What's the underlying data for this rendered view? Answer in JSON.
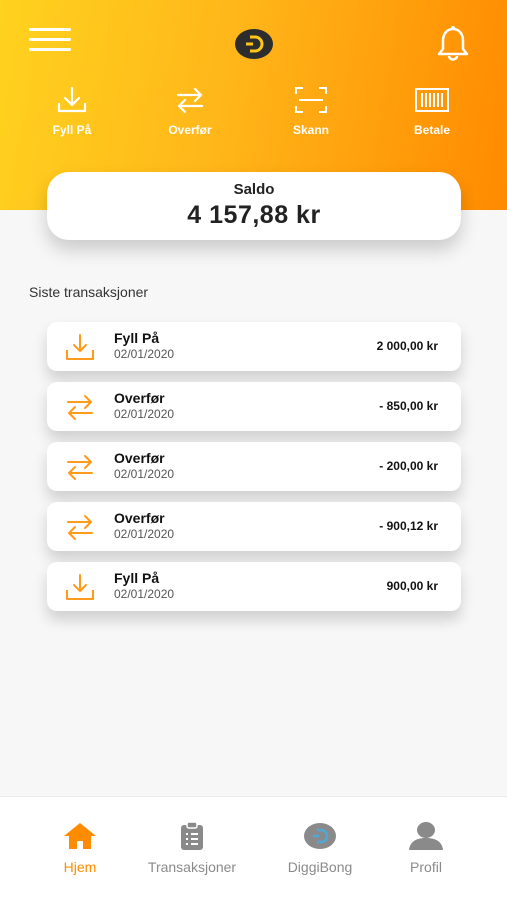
{
  "header": {
    "actions": [
      {
        "label": "Fyll På",
        "icon": "download-icon"
      },
      {
        "label": "Overfør",
        "icon": "transfer-arrows-icon"
      },
      {
        "label": "Skann",
        "icon": "scan-icon"
      },
      {
        "label": "Betale",
        "icon": "barcode-icon"
      }
    ]
  },
  "balance": {
    "title": "Saldo",
    "value": "4 157,88 kr"
  },
  "transactions": {
    "title": "Siste transaksjoner",
    "items": [
      {
        "name": "Fyll På",
        "date": "02/01/2020",
        "amount": "2 000,00 kr",
        "icon": "download-icon"
      },
      {
        "name": "Overfør",
        "date": "02/01/2020",
        "amount": "- 850,00 kr",
        "icon": "transfer-arrows-icon"
      },
      {
        "name": "Overfør",
        "date": "02/01/2020",
        "amount": "- 200,00 kr",
        "icon": "transfer-arrows-icon"
      },
      {
        "name": "Overfør",
        "date": "02/01/2020",
        "amount": "- 900,12 kr",
        "icon": "transfer-arrows-icon"
      },
      {
        "name": "Fyll På",
        "date": "02/01/2020",
        "amount": "900,00 kr",
        "icon": "download-icon"
      }
    ]
  },
  "nav": {
    "items": [
      {
        "label": "Hjem",
        "icon": "home-icon",
        "active": true
      },
      {
        "label": "Transaksjoner",
        "icon": "clipboard-icon",
        "active": false
      },
      {
        "label": "DiggiBong",
        "icon": "diggibong-logo-icon",
        "active": false
      },
      {
        "label": "Profil",
        "icon": "profile-icon",
        "active": false
      }
    ]
  },
  "colors": {
    "accent": "#ff8c00",
    "gradient_start": "#ffd21f",
    "gradient_end": "#ff8a00",
    "inactive": "#8a8a8a"
  }
}
